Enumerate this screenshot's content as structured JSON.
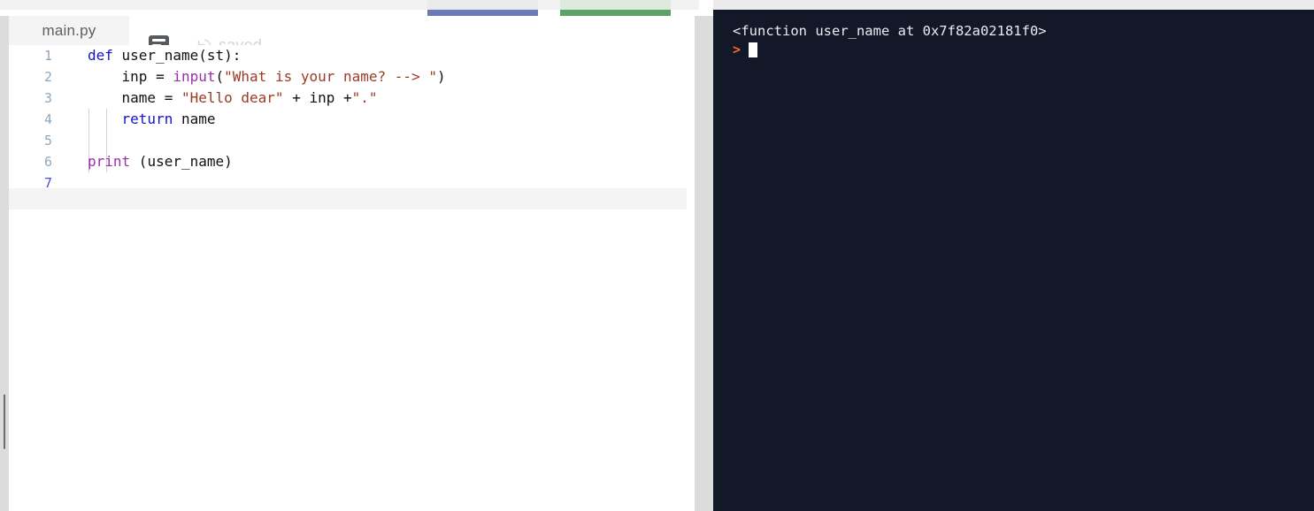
{
  "app": {
    "kind": "online-python-ide",
    "colors": {
      "run_button": "#6b7ab8",
      "stop_button": "#5ba368",
      "console_bg": "#121828",
      "prompt_accent": "#f26c27",
      "active_line_bg": "#f4f4f4",
      "rail_bg": "#dcdcdc"
    }
  },
  "toolbar": {
    "run_label": "",
    "stop_label": ""
  },
  "editor": {
    "tab": {
      "filename": "main.py"
    },
    "format_icon_name": "format-lines-icon",
    "save_state": {
      "icon_name": "history-icon",
      "label": "saved"
    },
    "active_line": 7,
    "lines": [
      {
        "number": "1",
        "tokens": [
          {
            "text": "def ",
            "type": "kw"
          },
          {
            "text": "user_name(st):",
            "type": "pl"
          }
        ]
      },
      {
        "number": "2",
        "tokens": [
          {
            "text": "    inp = ",
            "type": "pl"
          },
          {
            "text": "input",
            "type": "bi"
          },
          {
            "text": "(",
            "type": "pl"
          },
          {
            "text": "\"What is your name? --> \"",
            "type": "str"
          },
          {
            "text": ")",
            "type": "pl"
          }
        ]
      },
      {
        "number": "3",
        "tokens": [
          {
            "text": "    name = ",
            "type": "pl"
          },
          {
            "text": "\"Hello dear\"",
            "type": "str"
          },
          {
            "text": " + inp +",
            "type": "pl"
          },
          {
            "text": "\".\"",
            "type": "str"
          }
        ]
      },
      {
        "number": "4",
        "tokens": [
          {
            "text": "    ",
            "type": "pl"
          },
          {
            "text": "return",
            "type": "kw"
          },
          {
            "text": " name",
            "type": "pl"
          }
        ]
      },
      {
        "number": "5",
        "tokens": [
          {
            "text": "",
            "type": "pl"
          }
        ]
      },
      {
        "number": "6",
        "tokens": [
          {
            "text": "print",
            "type": "bi"
          },
          {
            "text": " (user_name)",
            "type": "pl"
          }
        ]
      },
      {
        "number": "7",
        "tokens": [
          {
            "text": "",
            "type": "pl"
          }
        ]
      }
    ]
  },
  "console": {
    "output": "<function user_name at 0x7f82a02181f0>",
    "prompt_symbol": ">",
    "input_value": ""
  }
}
